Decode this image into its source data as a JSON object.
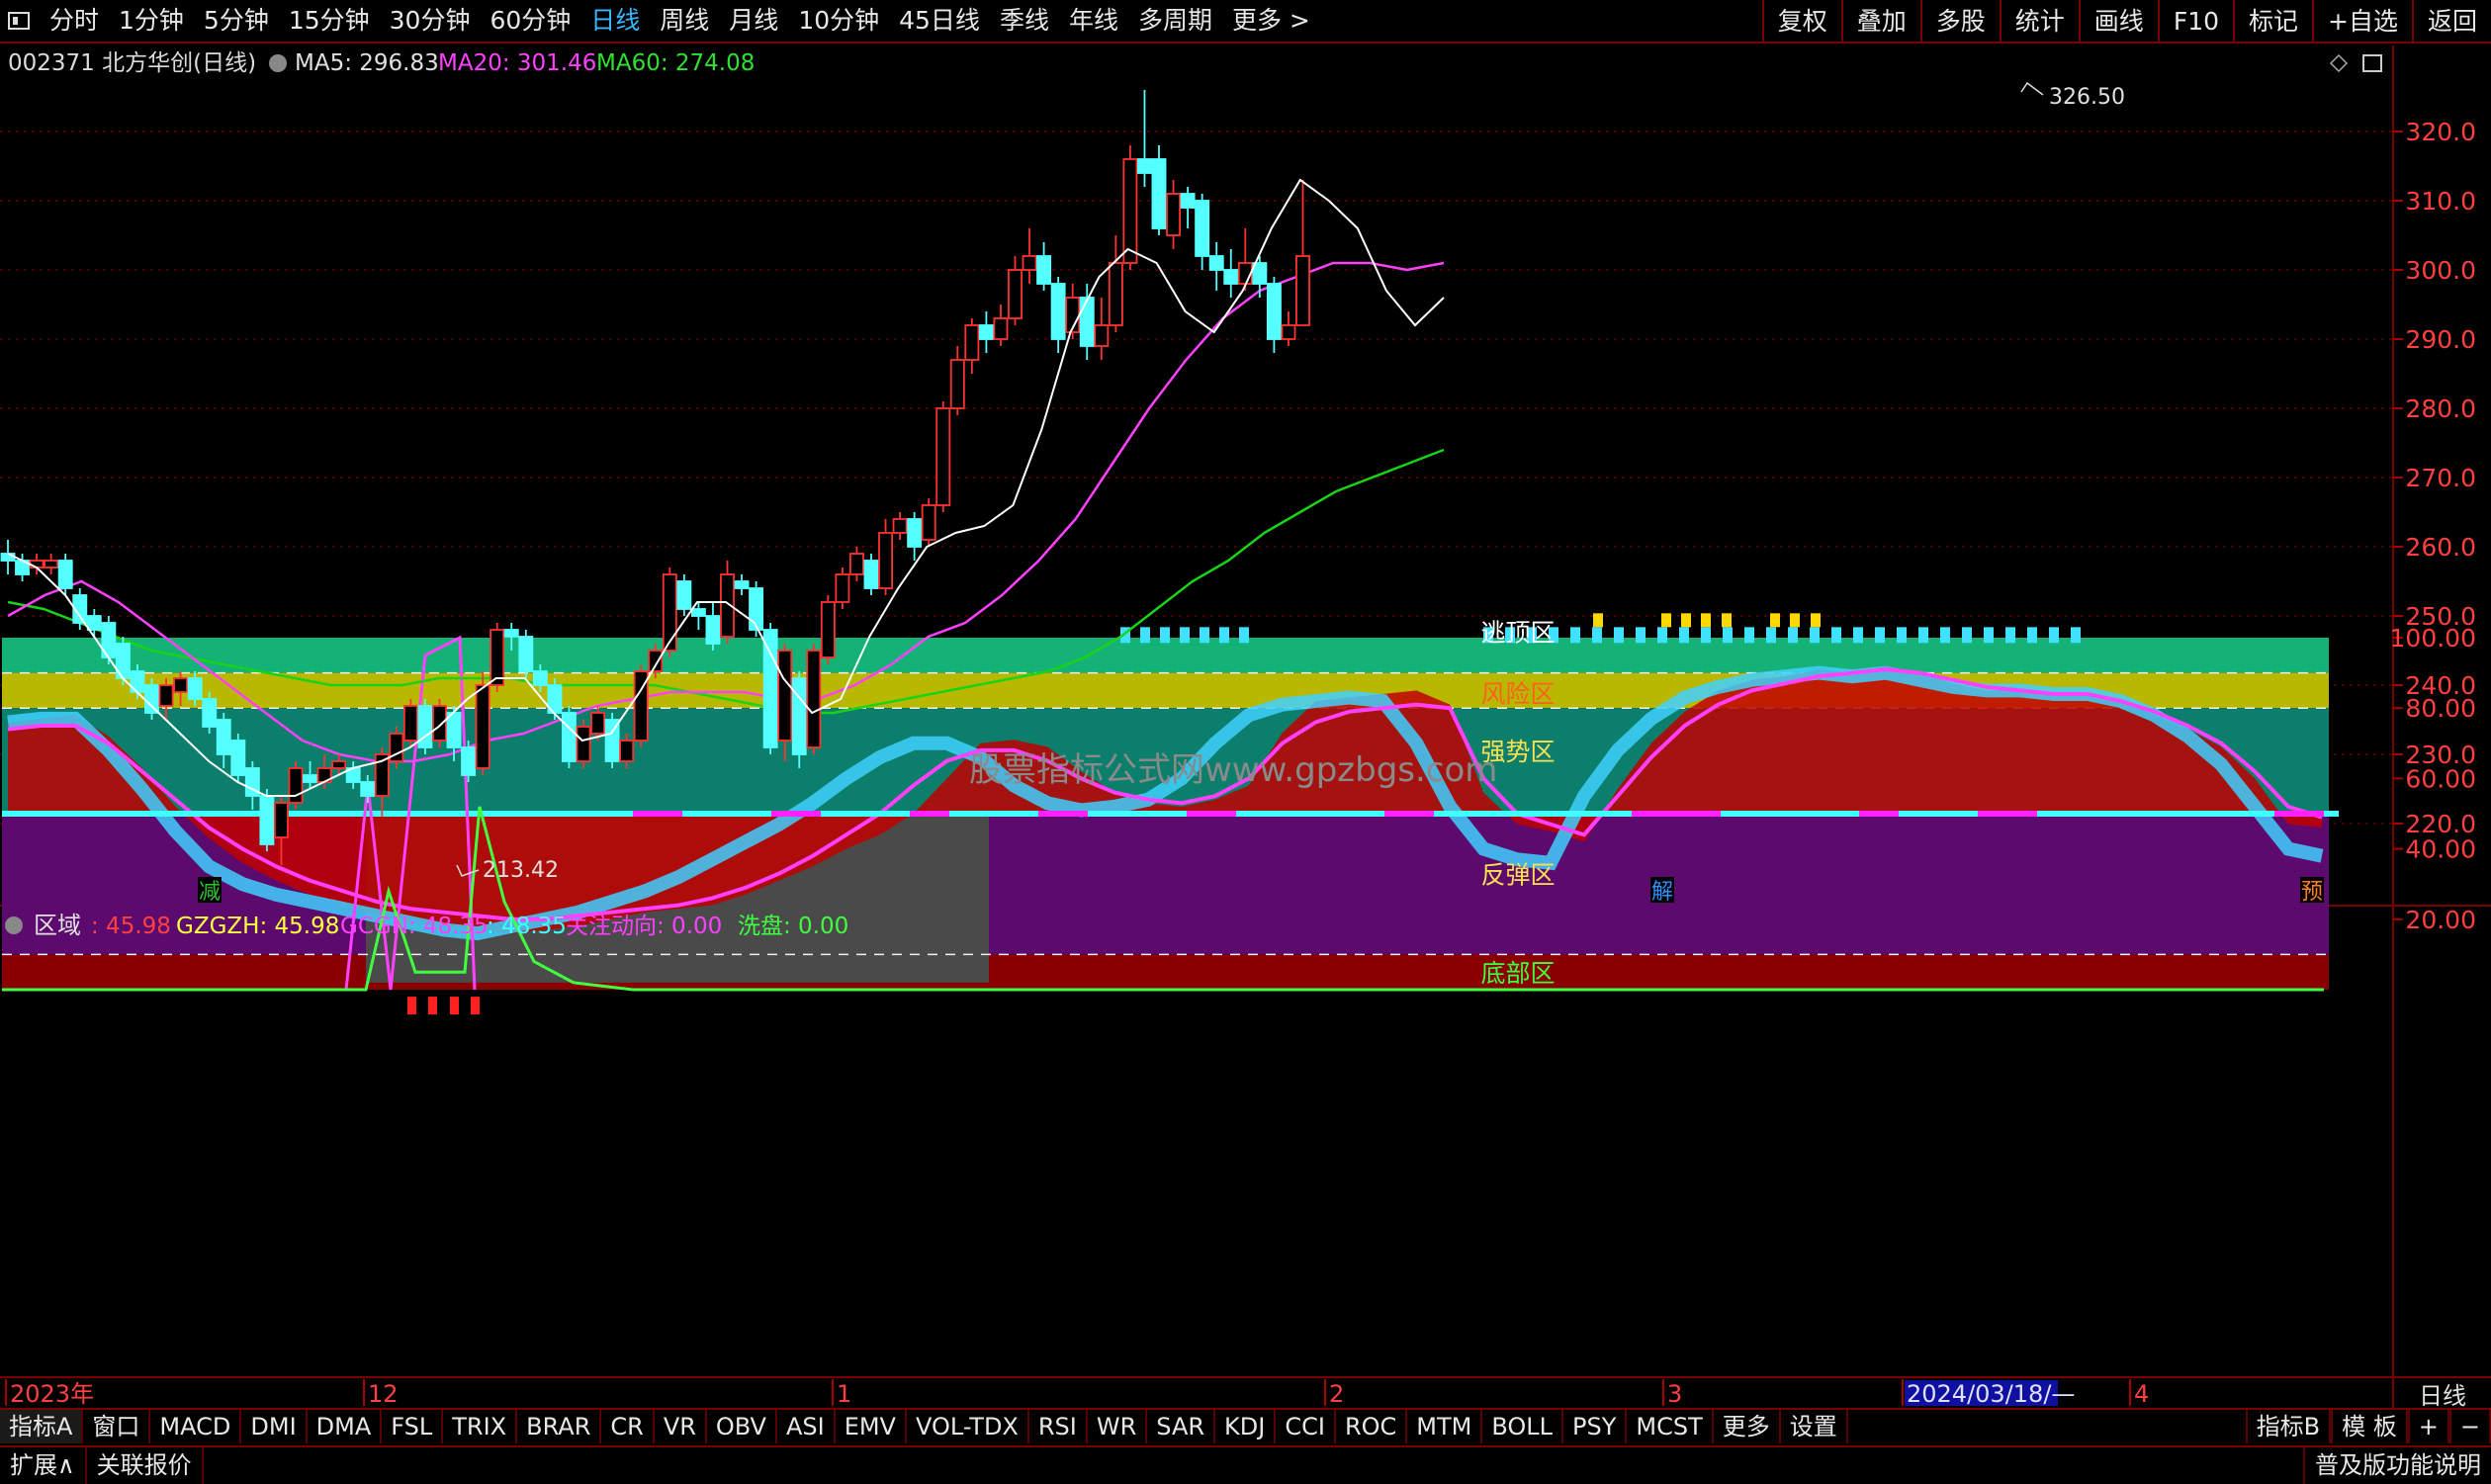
{
  "topbar": {
    "periods": [
      "分时",
      "1分钟",
      "5分钟",
      "15分钟",
      "30分钟",
      "60分钟",
      "日线",
      "周线",
      "月线",
      "10分钟",
      "45日线",
      "季线",
      "年线",
      "多周期",
      "更多 >"
    ],
    "active_period": "日线",
    "right_buttons": [
      "复权",
      "叠加",
      "多股",
      "统计",
      "画线",
      "F10",
      "标记",
      "+自选",
      "返回"
    ]
  },
  "main_chart": {
    "stock_label": "002371 北方华创(日线)",
    "ma5_label": "MA5: 296.83",
    "ma20_label": "MA20: 301.46",
    "ma60_label": "MA60: 274.08",
    "price_ticks": [
      "320.0",
      "310.0",
      "300.0",
      "290.0",
      "280.0",
      "270.0",
      "260.0",
      "250.0",
      "240.0",
      "230.0",
      "220.0"
    ],
    "high_label": "326.50",
    "low_label": "213.42",
    "watermark": "股票指标公式网www.gpzbgs.com",
    "markers": [
      "减",
      "解",
      "预"
    ],
    "colors": {
      "up": "#ff3232",
      "down": "#54ffff",
      "ma5": "#ffffff",
      "ma20": "#ff40ff",
      "ma60": "#18d418"
    }
  },
  "sub_chart": {
    "title": "区域",
    "values": [
      {
        "text": ": 45.98",
        "color": "#ff4040"
      },
      {
        "text": "GZGZH: 45.98",
        "color": "#ffff40"
      },
      {
        "text": "GCGN: 48.35",
        "color": "#ff40ff"
      },
      {
        "text": ": 48.35",
        "color": "#40ffff"
      },
      {
        "text": "关注动向: 0.00",
        "color": "#ff40ff"
      },
      {
        "text": "洗盘: 0.00",
        "color": "#40ff40"
      }
    ],
    "ticks": [
      "100.00",
      "80.00",
      "60.00",
      "40.00",
      "20.00"
    ],
    "zones": [
      "逃顶区",
      "风险区",
      "强势区",
      "反弹区",
      "底部区"
    ]
  },
  "date_axis": [
    "2023年",
    "12",
    "1",
    "2",
    "3",
    "2024/03/18/—",
    "4"
  ],
  "bottom_tabs": [
    "指标A",
    "窗口",
    "MACD",
    "DMI",
    "DMA",
    "FSL",
    "TRIX",
    "BRAR",
    "CR",
    "VR",
    "OBV",
    "ASI",
    "EMV",
    "VOL-TDX",
    "RSI",
    "WR",
    "SAR",
    "KDJ",
    "CCI",
    "ROC",
    "MTM",
    "BOLL",
    "PSY",
    "MCST",
    "更多",
    "设置"
  ],
  "bottom_right": [
    "指标B",
    "模 板",
    "+",
    "−"
  ],
  "right_label": "日线",
  "status": {
    "expand": "扩展∧",
    "related": "关联报价",
    "right": "普及版功能说明"
  }
}
